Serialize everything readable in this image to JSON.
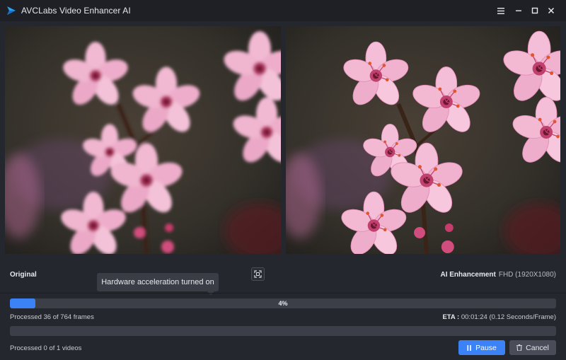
{
  "titlebar": {
    "title": "AVCLabs Video Enhancer AI",
    "icons": [
      "menu-icon",
      "minimize-icon",
      "maximize-icon",
      "close-icon"
    ]
  },
  "preview": {
    "left_label": "Original",
    "right_label": "AI Enhancement",
    "right_resolution": "FHD (1920X1080)"
  },
  "tooltip": {
    "text": "Hardware acceleration turned on"
  },
  "progress": {
    "frames_percent_label": "4%",
    "frames_fraction": 0.047,
    "frames_text": "Processed 36 of 764 frames",
    "eta_label": "ETA :",
    "eta_value": "00:01:24 (0.12 Seconds/Frame)",
    "videos_fraction": 0,
    "videos_text": "Processed 0 of 1 videos"
  },
  "buttons": {
    "pause_label": "Pause",
    "cancel_label": "Cancel"
  },
  "colors": {
    "accent": "#3b82f6",
    "background": "#25272e",
    "titlebar": "#1e2026"
  }
}
